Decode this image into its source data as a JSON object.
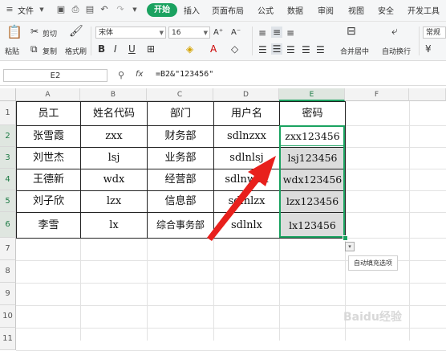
{
  "menubar": {
    "file": "文件",
    "tabs": [
      "开始",
      "插入",
      "页面布局",
      "公式",
      "数据",
      "审阅",
      "视图",
      "安全",
      "开发工具"
    ]
  },
  "ribbon": {
    "paste": "粘贴",
    "cut": "剪切",
    "copy": "复制",
    "format_painter": "格式刷",
    "font_name": "宋体",
    "font_size": "16",
    "merge_center": "合并居中",
    "auto_wrap": "自动换行",
    "number_format": "常规"
  },
  "formula_bar": {
    "cell_ref": "E2",
    "fx": "fx",
    "formula": "=B2&\"123456\""
  },
  "sheet": {
    "columns": [
      "A",
      "B",
      "C",
      "D",
      "E",
      "F"
    ],
    "rows": [
      "1",
      "2",
      "3",
      "4",
      "5",
      "6",
      "7",
      "8",
      "9",
      "10",
      "11"
    ],
    "headers": [
      "员工",
      "姓名代码",
      "部门",
      "用户名",
      "密码"
    ],
    "data": [
      [
        "张雪霞",
        "zxx",
        "财务部",
        "sdlnzxx",
        "zxx123456"
      ],
      [
        "刘世杰",
        "lsj",
        "业务部",
        "sdlnlsj",
        "lsj123456"
      ],
      [
        "王德新",
        "wdx",
        "经营部",
        "sdlnwdx",
        "wdx123456"
      ],
      [
        "刘子欣",
        "lzx",
        "信息部",
        "sdlnlzx",
        "lzx123456"
      ],
      [
        "李雪",
        "lx",
        "综合事务部",
        "sdlnlx",
        "lx123456"
      ]
    ]
  },
  "autofill": {
    "tooltip": "自动填充选项"
  },
  "watermark": "Baidu经验"
}
